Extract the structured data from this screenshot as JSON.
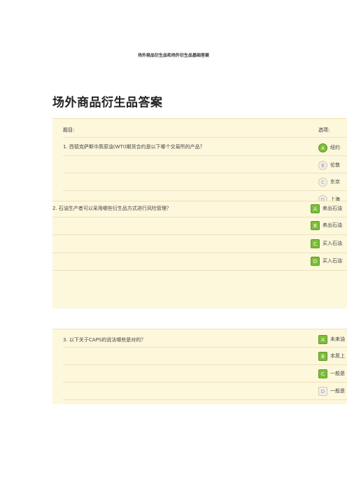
{
  "doc_header": "场外商品衍生品和场外衍生品基础答案",
  "page_title": "场外商品衍生品答案",
  "table_headers": {
    "question": "题目:",
    "options": "选项:"
  },
  "q1": {
    "text": "1. 西德克萨斯中质原油(WTI)期货合约是以下哪个交易所的产品？",
    "options": [
      {
        "letter": "A",
        "text": "纽约",
        "state": "selected"
      },
      {
        "letter": "B",
        "text": "伦敦",
        "state": "unselected"
      },
      {
        "letter": "C",
        "text": "东京",
        "state": "unselected"
      },
      {
        "letter": "D",
        "text": "上海",
        "state": "unselected"
      }
    ]
  },
  "q2": {
    "text": "2. 石油生产者可以采用哪些衍生品方式进行风险管理？",
    "options": [
      {
        "letter": "A",
        "text": "卖出石油",
        "state": "selected"
      },
      {
        "letter": "B",
        "text": "卖出石油",
        "state": "selected"
      },
      {
        "letter": "C",
        "text": "买入石油",
        "state": "selected"
      },
      {
        "letter": "D",
        "text": "买入石油",
        "state": "selected"
      }
    ]
  },
  "q3": {
    "text": "3. 以下关于CAPS的说法哪些是对的？",
    "options": [
      {
        "letter": "A",
        "text": "未来油",
        "state": "selected"
      },
      {
        "letter": "B",
        "text": "本质上",
        "state": "selected"
      },
      {
        "letter": "C",
        "text": "一般是",
        "state": "selected"
      },
      {
        "letter": "D",
        "text": "一般是",
        "state": "unselected"
      }
    ]
  }
}
